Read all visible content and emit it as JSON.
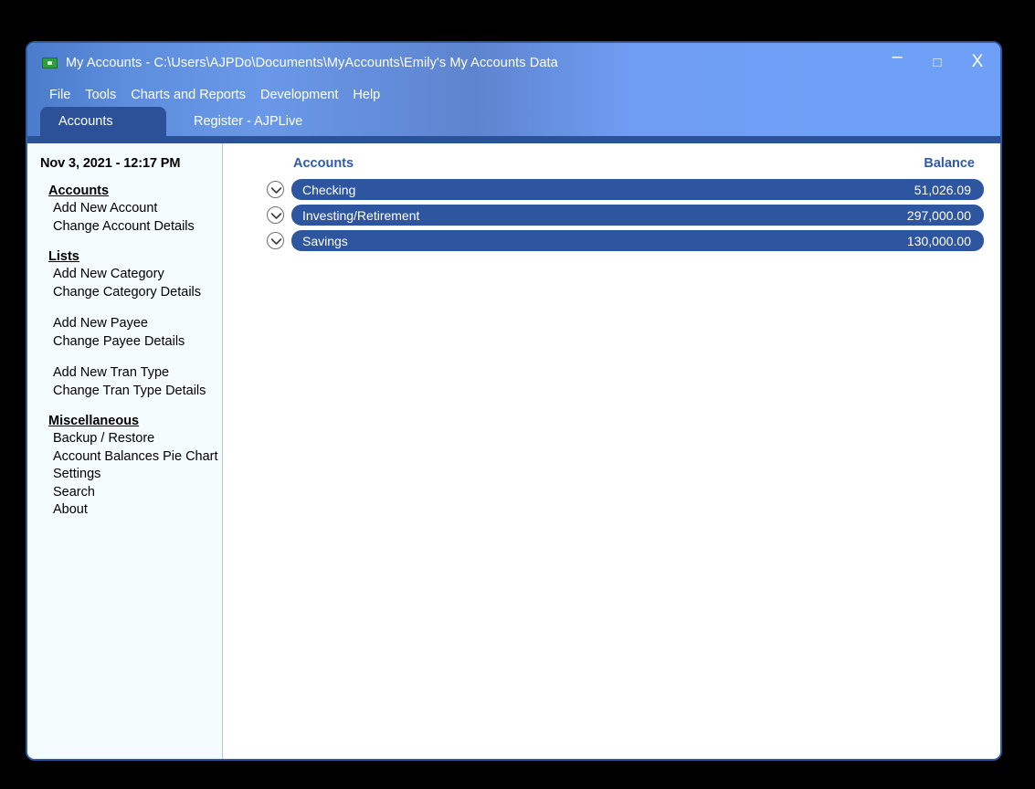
{
  "window": {
    "title": "My Accounts - C:\\Users\\AJPDo\\Documents\\MyAccounts\\Emily's My Accounts Data",
    "icon": "money-bill-icon",
    "controls": {
      "minimize": "–",
      "maximize": "□",
      "close": "X"
    }
  },
  "menubar": {
    "items": [
      {
        "label": "File"
      },
      {
        "label": "Tools"
      },
      {
        "label": "Charts and Reports"
      },
      {
        "label": "Development"
      },
      {
        "label": "Help"
      }
    ]
  },
  "tabs": [
    {
      "label": "Accounts",
      "active": true
    },
    {
      "label": "Register - AJPLive",
      "active": false
    }
  ],
  "sidebar": {
    "datetime": "Nov 3, 2021 - 12:17 PM",
    "groups": [
      {
        "title": "Accounts",
        "items": [
          {
            "label": "Add New Account"
          },
          {
            "label": "Change Account Details"
          }
        ]
      },
      {
        "title": "Lists",
        "items": [
          {
            "label": "Add New Category"
          },
          {
            "label": "Change Category Details"
          }
        ]
      },
      {
        "title": "",
        "items": [
          {
            "label": "Add New Payee"
          },
          {
            "label": "Change Payee Details"
          }
        ]
      },
      {
        "title": "",
        "items": [
          {
            "label": "Add New Tran Type"
          },
          {
            "label": "Change Tran Type Details"
          }
        ]
      },
      {
        "title": "Miscellaneous",
        "items": [
          {
            "label": "Backup / Restore"
          },
          {
            "label": "Account Balances Pie Chart"
          },
          {
            "label": "Settings"
          },
          {
            "label": "Search"
          },
          {
            "label": "About"
          }
        ]
      }
    ]
  },
  "main": {
    "columns": {
      "accounts": "Accounts",
      "balance": "Balance"
    },
    "accounts": [
      {
        "name": "Checking",
        "balance": "51,026.09",
        "expander": "chevron-down-icon"
      },
      {
        "name": "Investing/Retirement",
        "balance": "297,000.00",
        "expander": "chevron-down-icon"
      },
      {
        "name": "Savings",
        "balance": "130,000.00",
        "expander": "chevron-down-icon"
      }
    ]
  },
  "colors": {
    "titlebar_light": "#6fa0f7",
    "titlebar_dark": "#4a7ccb",
    "tab_active": "#2d5199",
    "row_bar": "#2e55a0",
    "header_text": "#2e5aa8",
    "sidebar_bg": "#f4fcfd",
    "window_border": "#2f5aa8",
    "desktop_bg": "#000000"
  }
}
